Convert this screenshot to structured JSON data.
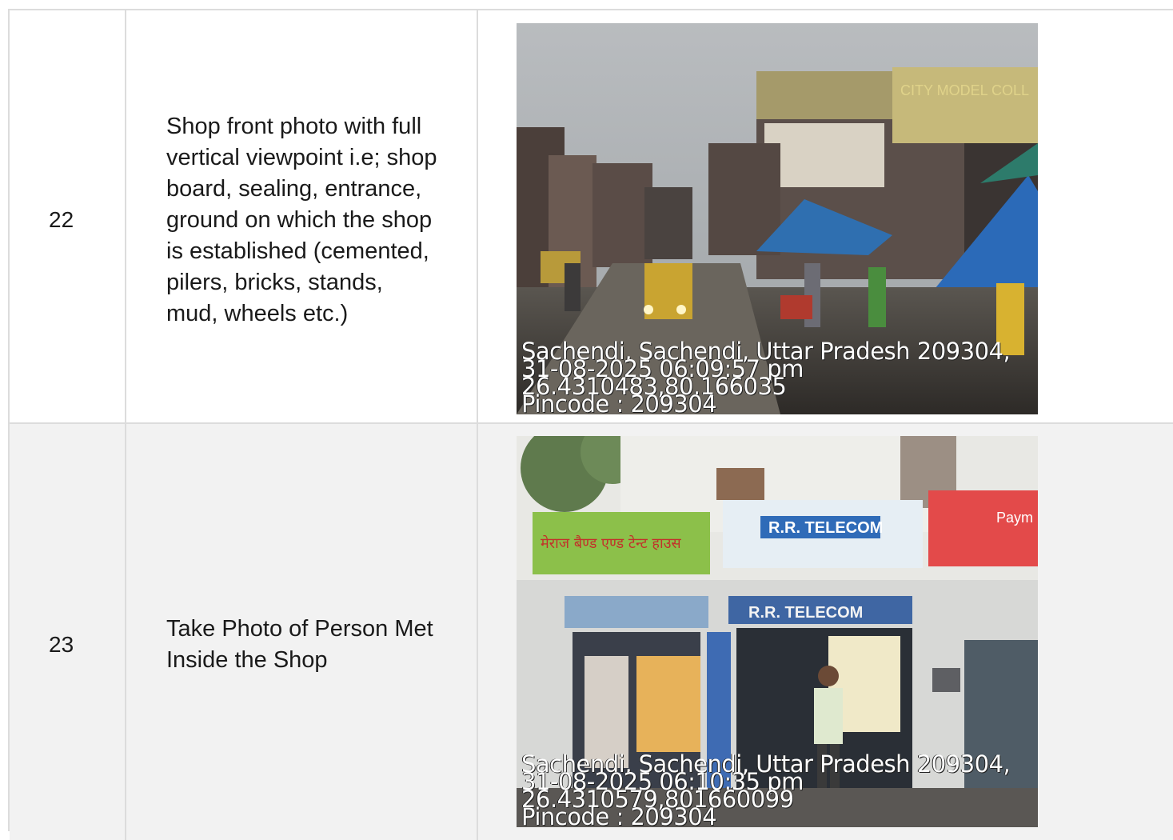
{
  "rows": [
    {
      "number": "22",
      "description": "Shop front photo with full\nvertical viewpoint i.e; shop\nboard, sealing, entrance,\nground on which the shop\nis established (cemented,\npilers, bricks, stands,\nmud, wheels etc.)",
      "photo": {
        "subject": "street-market-photo",
        "sign_text": "CITY MODEL COLL",
        "overlay": {
          "address": "Sachendi, Sachendi, Uttar Pradesh 209304,",
          "datetime": "31-08-2025  06:09:57  pm",
          "coords": "26.4310483,80.166035",
          "pincode": "Pincode : 209304"
        }
      }
    },
    {
      "number": "23",
      "description": "Take Photo of Person Met\nInside the Shop",
      "photo": {
        "subject": "shop-front-photo",
        "sign_left": "मेराज बैण्ड एण्ड टेन्ट हाउस",
        "sign_right": "R.R. TELECOM",
        "sign_right_lower": "R.R. TELECOM",
        "sign_bank": "Paym\nBank",
        "overlay": {
          "address": "Sachendi, Sachendi, Uttar Pradesh 209304,",
          "datetime": "31-08-2025  06:10:35  pm",
          "coords": "26.4310579,801660099",
          "pincode": "Pincode : 209304"
        }
      }
    }
  ],
  "colors": {
    "border": "#dcdcdc",
    "row_alt": "#f2f2f2",
    "overlay_text": "#ffffff"
  }
}
